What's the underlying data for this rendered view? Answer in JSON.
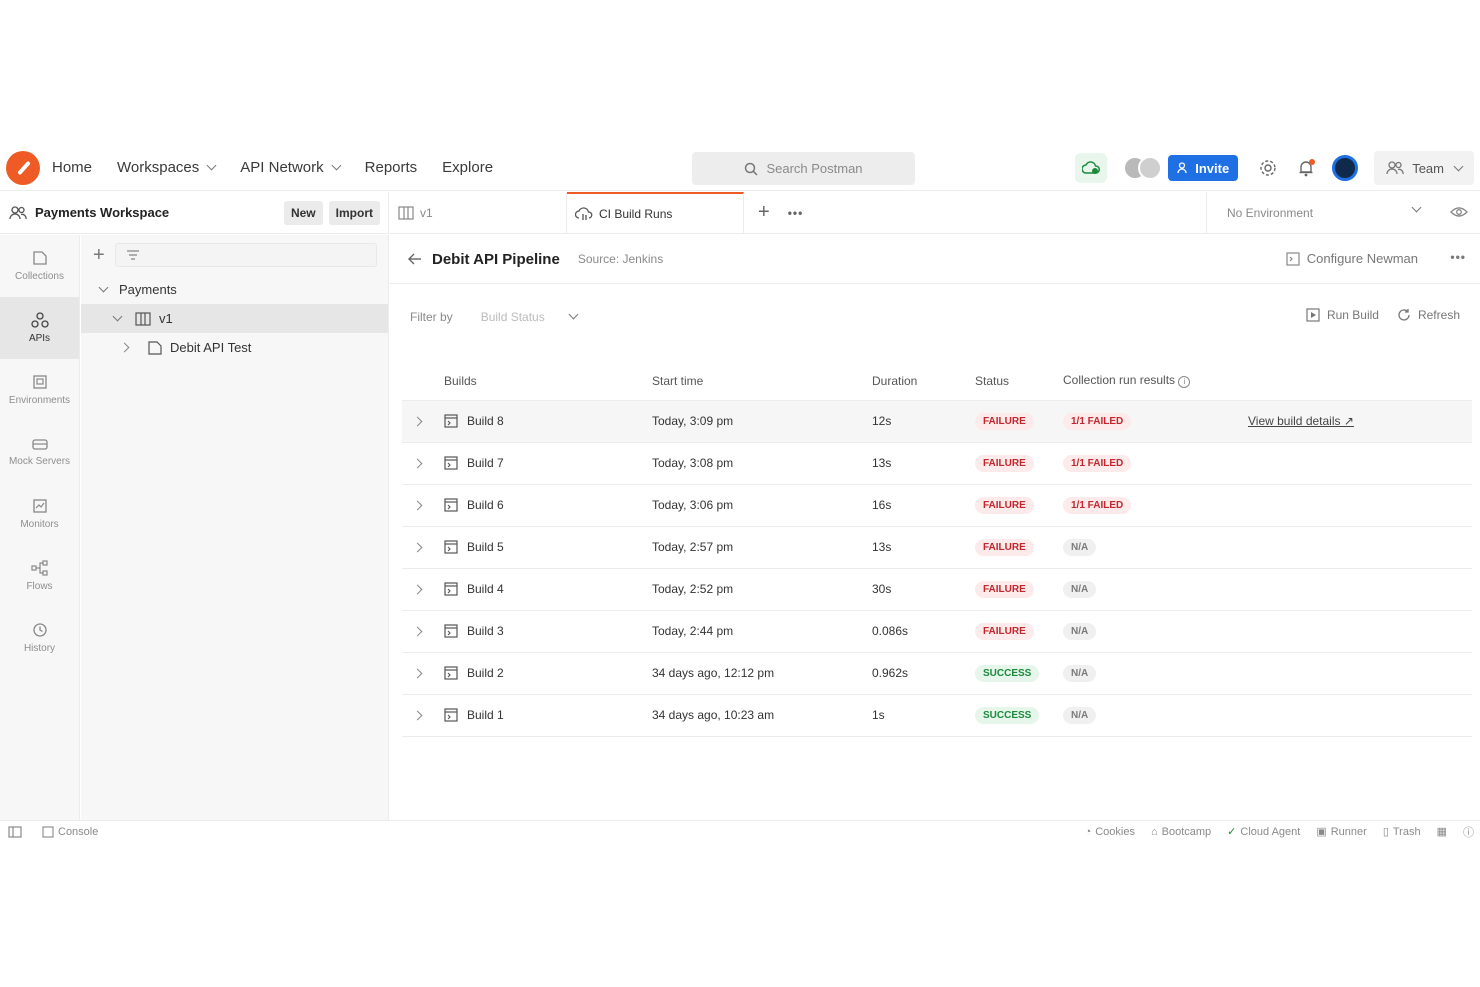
{
  "nav": {
    "links": [
      "Home",
      "Workspaces",
      "API Network",
      "Reports",
      "Explore"
    ],
    "search_placeholder": "Search Postman",
    "invite_label": "Invite",
    "team_label": "Team"
  },
  "workspace": {
    "name": "Payments Workspace",
    "new_label": "New",
    "import_label": "Import"
  },
  "tabs": [
    {
      "label": "v1",
      "icon": "api-icon"
    },
    {
      "label": "CI Build Runs",
      "icon": "cloud-build-icon"
    }
  ],
  "environment": "No Environment",
  "rail": [
    {
      "label": "Collections",
      "icon": "collections-icon"
    },
    {
      "label": "APIs",
      "icon": "apis-icon"
    },
    {
      "label": "Environments",
      "icon": "environments-icon"
    },
    {
      "label": "Mock Servers",
      "icon": "mock-servers-icon"
    },
    {
      "label": "Monitors",
      "icon": "monitors-icon"
    },
    {
      "label": "Flows",
      "icon": "flows-icon"
    },
    {
      "label": "History",
      "icon": "history-icon"
    }
  ],
  "tree": {
    "root": "Payments",
    "version": "v1",
    "child": "Debit API Test"
  },
  "page": {
    "title": "Debit API Pipeline",
    "source": "Source: Jenkins",
    "configure_label": "Configure Newman",
    "filter_label": "Filter by",
    "filter_placeholder": "Build Status",
    "run_build_label": "Run Build",
    "refresh_label": "Refresh"
  },
  "table": {
    "headers": [
      "Builds",
      "Start time",
      "Duration",
      "Status",
      "Collection run results"
    ],
    "view_details_label": "View build details ↗",
    "rows": [
      {
        "build": "Build 8",
        "start": "Today, 3:09 pm",
        "duration": "12s",
        "status": "FAILURE",
        "result": "1/1 FAILED"
      },
      {
        "build": "Build 7",
        "start": "Today, 3:08 pm",
        "duration": "13s",
        "status": "FAILURE",
        "result": "1/1 FAILED"
      },
      {
        "build": "Build 6",
        "start": "Today, 3:06 pm",
        "duration": "16s",
        "status": "FAILURE",
        "result": "1/1 FAILED"
      },
      {
        "build": "Build 5",
        "start": "Today, 2:57 pm",
        "duration": "13s",
        "status": "FAILURE",
        "result": "N/A"
      },
      {
        "build": "Build 4",
        "start": "Today, 2:52 pm",
        "duration": "30s",
        "status": "FAILURE",
        "result": "N/A"
      },
      {
        "build": "Build 3",
        "start": "Today, 2:44 pm",
        "duration": "0.086s",
        "status": "FAILURE",
        "result": "N/A"
      },
      {
        "build": "Build 2",
        "start": "34 days ago, 12:12 pm",
        "duration": "0.962s",
        "status": "SUCCESS",
        "result": "N/A"
      },
      {
        "build": "Build 1",
        "start": "34 days ago, 10:23 am",
        "duration": "1s",
        "status": "SUCCESS",
        "result": "N/A"
      }
    ]
  },
  "statusbar": {
    "console": "Console",
    "items": [
      "Cookies",
      "Bootcamp",
      "Cloud Agent",
      "Runner",
      "Trash"
    ]
  },
  "colors": {
    "accent": "#ef5b25",
    "primary": "#1f6fe5",
    "failure": "#c1272d",
    "success": "#1b8a3c"
  }
}
